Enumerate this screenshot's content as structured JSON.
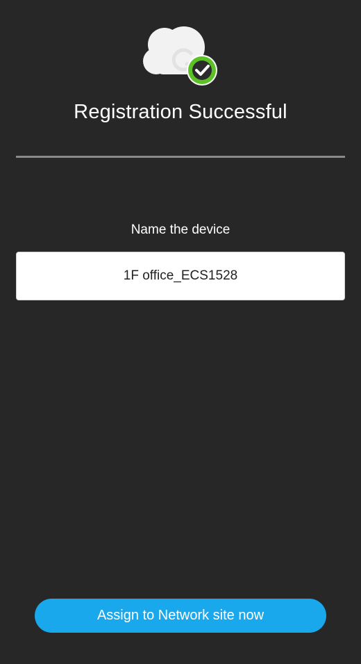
{
  "header": {
    "icon": "cloud-check-icon",
    "title": "Registration Successful"
  },
  "device": {
    "label": "Name the device",
    "name_value": "1F office_ECS1528"
  },
  "actions": {
    "assign_label": "Assign to Network site now"
  },
  "colors": {
    "background": "#272727",
    "accent": "#1aa8ec",
    "success": "#5cc126",
    "divider": "#8a8a8a"
  }
}
